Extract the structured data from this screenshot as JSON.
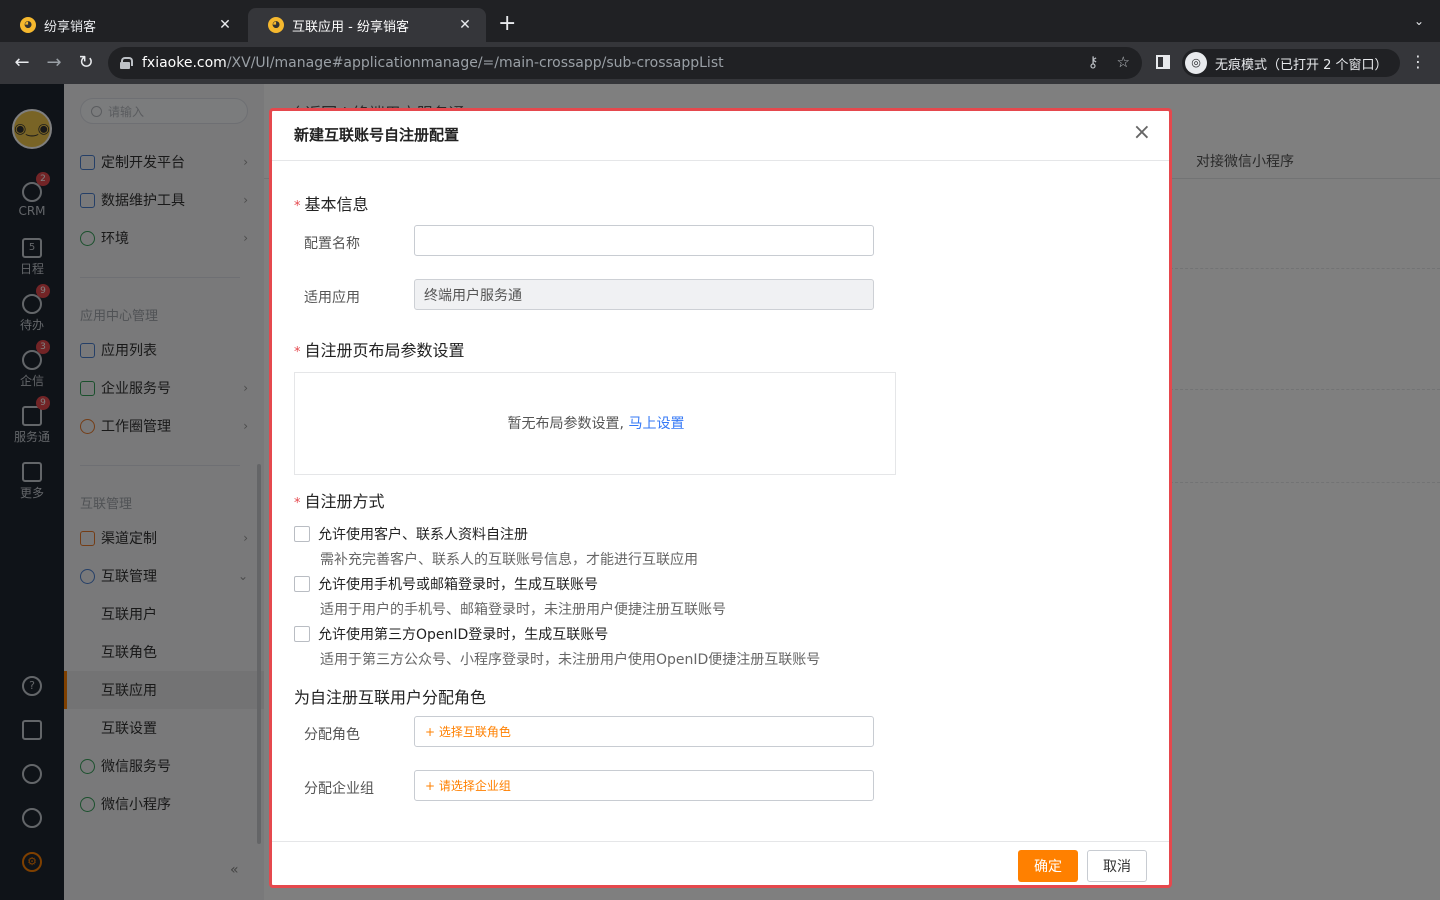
{
  "browser": {
    "tabs": [
      {
        "title": "纷享销客",
        "active": false
      },
      {
        "title": "互联应用 - 纷享销客",
        "active": true
      }
    ],
    "url_host": "fxiaoke.com",
    "url_path": "/XV/UI/manage#applicationmanage/=/main-crossapp/sub-crossappList",
    "incognito_label": "无痕模式（已打开 2 个窗口）"
  },
  "leftbar": {
    "items": [
      {
        "label": "CRM",
        "badge": "2",
        "icon": "pie-chart-icon"
      },
      {
        "label": "日程",
        "badge": "",
        "icon": "calendar-icon"
      },
      {
        "label": "待办",
        "badge": "9",
        "icon": "check-circle-icon"
      },
      {
        "label": "企信",
        "badge": "3",
        "icon": "chat-bubble-icon"
      },
      {
        "label": "服务通",
        "badge": "9",
        "icon": "service-icon"
      },
      {
        "label": "更多",
        "badge": "",
        "icon": "grid-icon"
      }
    ],
    "calendar_day": "5"
  },
  "sidenav": {
    "search_placeholder": "请输入",
    "top_items": [
      "定制开发平台",
      "数据维护工具",
      "环境"
    ],
    "group1_title": "应用中心管理",
    "group1_items": [
      "应用列表",
      "企业服务号",
      "工作圈管理"
    ],
    "group2_title": "互联管理",
    "group2_items": [
      "渠道定制",
      "互联管理"
    ],
    "sub_items": [
      "互联用户",
      "互联角色",
      "互联应用",
      "互联设置"
    ],
    "bottom_items": [
      "微信服务号",
      "微信小程序"
    ]
  },
  "content": {
    "header": "〈 返回  |  终端用户服务通",
    "tab_right": "对接微信小程序"
  },
  "modal": {
    "title": "新建互联账号自注册配置",
    "close": "×",
    "section_basic": "基本信息",
    "label_name": "配置名称",
    "value_name": "",
    "label_app": "适用应用",
    "value_app": "终端用户服务通",
    "section_layout": "自注册页布局参数设置",
    "empty_text": "暂无布局参数设置,",
    "empty_link": "马上设置",
    "section_method": "自注册方式",
    "options": [
      {
        "label": "允许使用客户、联系人资料自注册",
        "desc": "需补充完善客户、联系人的互联账号信息，才能进行互联应用",
        "checked": false
      },
      {
        "label": "允许使用手机号或邮箱登录时，生成互联账号",
        "desc": "适用于用户的手机号、邮箱登录时，未注册用户便捷注册互联账号",
        "checked": false
      },
      {
        "label": "允许使用第三方OpenID登录时，生成互联账号",
        "desc": "适用于第三方公众号、小程序登录时，未注册用户使用OpenID便捷注册互联账号",
        "checked": false
      }
    ],
    "section_role": "为自注册互联用户分配角色",
    "label_role": "分配角色",
    "picker_role": "+ 选择互联角色",
    "label_group": "分配企业组",
    "picker_group": "+ 请选择企业组",
    "btn_ok": "确定",
    "btn_cancel": "取消"
  },
  "colors": {
    "accent": "#ff8000",
    "link": "#3478f6",
    "required": "#e5484d",
    "highlight_border": "#e5484d"
  }
}
